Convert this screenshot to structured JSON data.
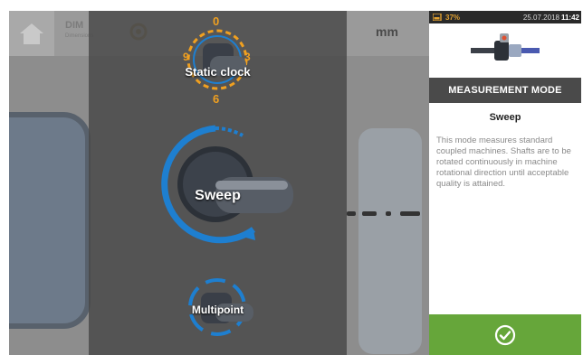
{
  "toolbar": {
    "dim_label": "DIM",
    "dim_sub": "Dimensions",
    "unit": "mm"
  },
  "modes": {
    "static_clock": {
      "label": "Static clock",
      "dial_top": "0",
      "dial_right": "3",
      "dial_left": "9",
      "dial_bottom": "6"
    },
    "sweep": {
      "label": "Sweep"
    },
    "multipoint": {
      "label": "Multipoint"
    }
  },
  "status_bar": {
    "battery": "37%",
    "date": "25.07.2018",
    "time": "11:42"
  },
  "panel": {
    "header": "MEASUREMENT MODE",
    "selected_mode": "Sweep",
    "description": "This mode measures standard coupled machines. Shafts are to be rotated continuously in machine rotational direction until acceptable quality is attained."
  },
  "colors": {
    "accent_blue": "#1e7fd0",
    "ok_green": "#66a63a",
    "clock_orange": "#f0a020"
  },
  "icons": {
    "home": "home-icon",
    "confirm": "check-circle-icon"
  }
}
